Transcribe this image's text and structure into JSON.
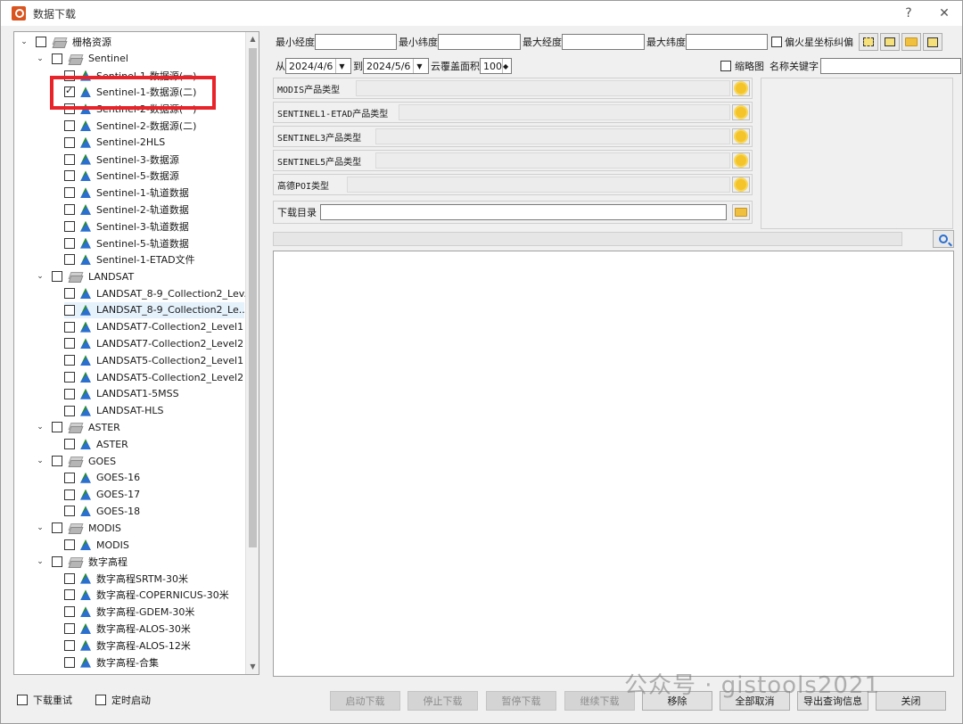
{
  "window": {
    "title": "数据下载",
    "help": "?",
    "close": "✕"
  },
  "tree": {
    "root": "栅格资源",
    "groups": [
      {
        "label": "Sentinel",
        "items": [
          "Sentinel-1-数据源(一)",
          "Sentinel-1-数据源(二)",
          "Sentinel-2-数据源(一)",
          "Sentinel-2-数据源(二)",
          "Sentinel-2HLS",
          "Sentinel-3-数据源",
          "Sentinel-5-数据源",
          "Sentinel-1-轨道数据",
          "Sentinel-2-轨道数据",
          "Sentinel-3-轨道数据",
          "Sentinel-5-轨道数据",
          "Sentinel-1-ETAD文件"
        ]
      },
      {
        "label": "LANDSAT",
        "items": [
          "LANDSAT_8-9_Collection2_Lev...",
          "LANDSAT_8-9_Collection2_Le...",
          "LANDSAT7-Collection2_Level1",
          "LANDSAT7-Collection2_Level2",
          "LANDSAT5-Collection2_Level1",
          "LANDSAT5-Collection2_Level2",
          "LANDSAT1-5MSS",
          "LANDSAT-HLS"
        ]
      },
      {
        "label": "ASTER",
        "items": [
          "ASTER"
        ]
      },
      {
        "label": "GOES",
        "items": [
          "GOES-16",
          "GOES-17",
          "GOES-18"
        ]
      },
      {
        "label": "MODIS",
        "items": [
          "MODIS"
        ]
      },
      {
        "label": "数字高程",
        "items": [
          "数字高程SRTM-30米",
          "数字高程-COPERNICUS-30米",
          "数字高程-GDEM-30米",
          "数字高程-ALOS-30米",
          "数字高程-ALOS-12米",
          "数字高程-合集"
        ]
      }
    ],
    "checked_item": "Sentinel-1-数据源(二)",
    "selected_item": "LANDSAT_8-9_Collection2_Le..."
  },
  "filters": {
    "min_lon_label": "最小经度",
    "min_lat_label": "最小纬度",
    "max_lon_label": "最大经度",
    "max_lat_label": "最大纬度",
    "mars_label": "偏火星坐标纠偏",
    "from_label": "从",
    "from_date": "2024/4/6",
    "to_label": "到",
    "to_date": "2024/5/6",
    "cloud_label": "云覆盖面积",
    "cloud_value": "100",
    "thumb_label": "缩略图",
    "keyword_label": "名称关键字"
  },
  "products": [
    {
      "label": "MODIS产品类型"
    },
    {
      "label": "SENTINEL1-ETAD产品类型"
    },
    {
      "label": "SENTINEL3产品类型"
    },
    {
      "label": "SENTINEL5产品类型"
    },
    {
      "label": "高德POI类型"
    }
  ],
  "download_dir_label": "下载目录",
  "bottom": {
    "retry_label": "下载重试",
    "timer_label": "定时启动",
    "buttons": [
      "启动下载",
      "停止下载",
      "暂停下载",
      "继续下载",
      "移除",
      "全部取消",
      "导出查询信息",
      "关闭"
    ]
  },
  "watermark": "公众号 · gistools2021",
  "colors": {
    "highlight": "#e8232a",
    "selected_row": "#e5f1fb"
  }
}
